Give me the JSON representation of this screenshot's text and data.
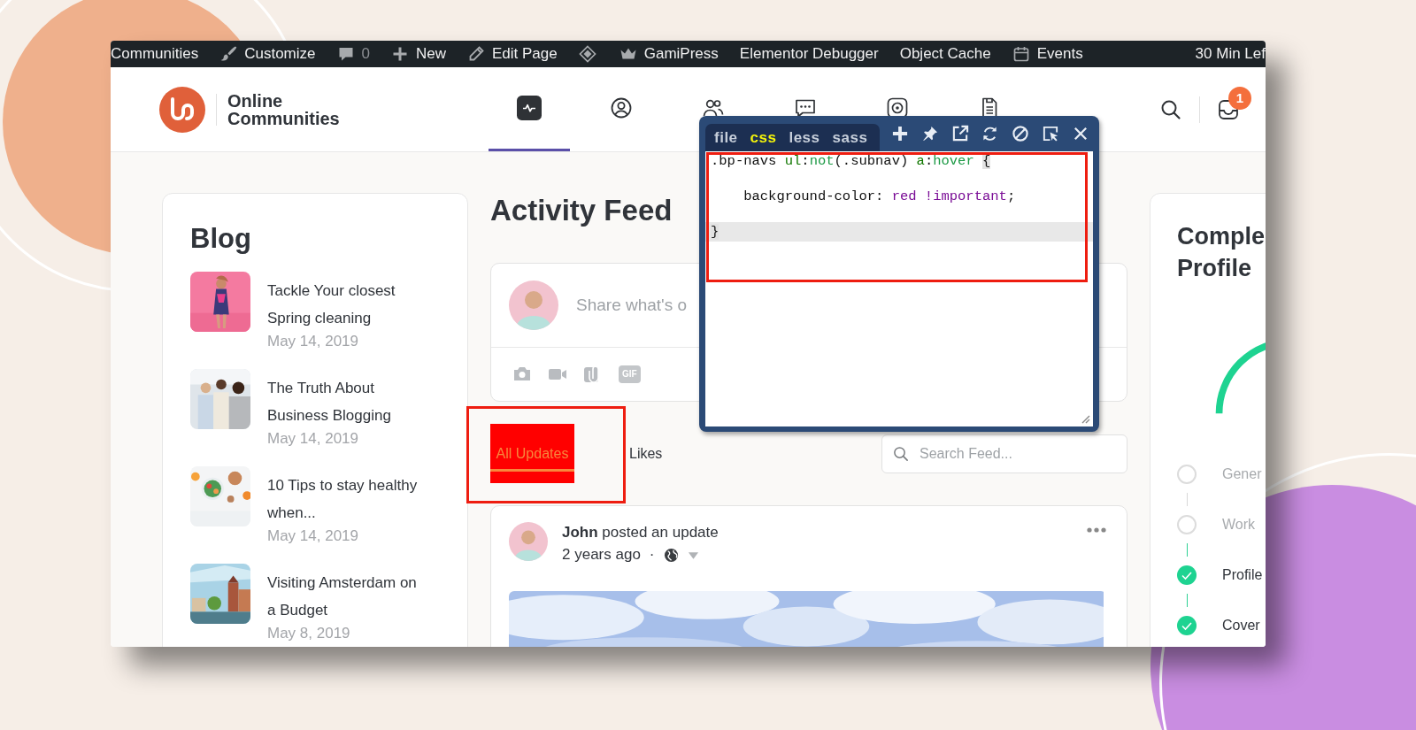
{
  "admin_bar": {
    "items": [
      {
        "label": "Communities"
      },
      {
        "label": "Customize"
      },
      {
        "label": "0"
      },
      {
        "label": "New"
      },
      {
        "label": "Edit Page"
      },
      {
        "label": "GamiPress"
      },
      {
        "label": "Elementor Debugger"
      },
      {
        "label": "Object Cache"
      },
      {
        "label": "Events"
      }
    ],
    "timer": "30 Min Lef"
  },
  "header": {
    "site_name": "Online Communities",
    "main_nav": [
      {
        "selected": true
      },
      {
        "selected": false
      },
      {
        "selected": false
      },
      {
        "selected": false
      },
      {
        "selected": false
      },
      {
        "selected": false
      }
    ],
    "inbox_badge": "1"
  },
  "blog": {
    "title": "Blog",
    "posts": [
      {
        "title": "Tackle Your closest Spring cleaning",
        "date": "May 14, 2019"
      },
      {
        "title": "The Truth About Business Blogging",
        "date": "May 14, 2019"
      },
      {
        "title": "10 Tips to stay healthy when...",
        "date": "May 14, 2019"
      },
      {
        "title": "Visiting Amsterdam on a Budget",
        "date": "May 8, 2019"
      }
    ]
  },
  "feed": {
    "title": "Activity Feed",
    "composer": {
      "placeholder": "Share what's o",
      "gif_label": "GIF"
    },
    "tabs": [
      {
        "label": "All Updates",
        "selected": true
      },
      {
        "label": "Likes",
        "selected": false
      }
    ],
    "search": {
      "placeholder": "Search Feed..."
    },
    "post": {
      "headline": "**John** posted an update",
      "time": "2 years ago",
      "separator": "·"
    }
  },
  "profile": {
    "title": "Comple\nProfile",
    "steps": [
      {
        "label": "Gener",
        "done": false
      },
      {
        "label": "Work",
        "done": false
      },
      {
        "label": "Profile",
        "done": true
      },
      {
        "label": "Cover",
        "done": true
      }
    ]
  },
  "css_editor": {
    "tabs": [
      {
        "label": "file",
        "selected": false
      },
      {
        "label": "css",
        "selected": true
      },
      {
        "label": "less",
        "selected": false
      },
      {
        "label": "sass",
        "selected": false
      }
    ],
    "lines": [
      {
        "active": false,
        "tokens": [
          {
            "text": ".bp-navs ",
            "kind": "plain"
          },
          {
            "text": "ul",
            "kind": "tag"
          },
          {
            "text": ":",
            "kind": "plain"
          },
          {
            "text": "not",
            "kind": "pseudo"
          },
          {
            "text": "(.subnav) ",
            "kind": "plain"
          },
          {
            "text": "a",
            "kind": "tag"
          },
          {
            "text": ":",
            "kind": "plain"
          },
          {
            "text": "hover ",
            "kind": "pseudo"
          },
          {
            "text": "{",
            "kind": "brace"
          }
        ]
      },
      {
        "active": false,
        "tokens": [
          {
            "text": "    background-color: ",
            "kind": "plain"
          },
          {
            "text": "red !important",
            "kind": "value"
          },
          {
            "text": ";",
            "kind": "plain"
          }
        ]
      },
      {
        "active": true,
        "tokens": [
          {
            "text": "}",
            "kind": "brace"
          }
        ]
      }
    ]
  }
}
